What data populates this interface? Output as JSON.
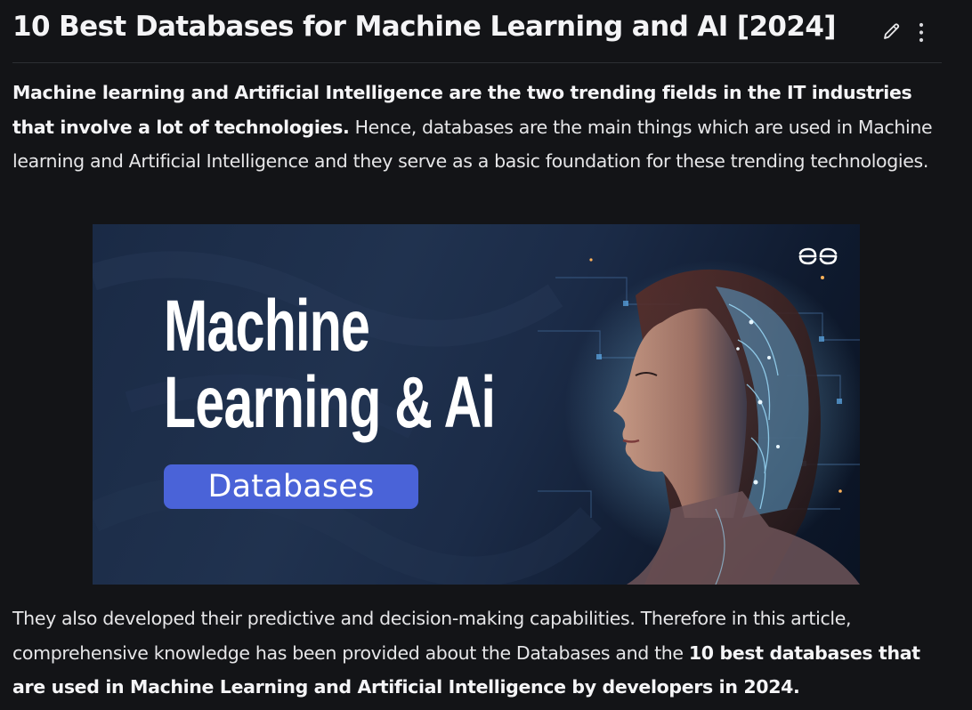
{
  "article": {
    "title": "10 Best Databases for Machine Learning and AI [2024]",
    "intro": {
      "bold": "Machine learning and Artificial Intelligence are the two trending fields in the IT industries that involve a lot of technologies.",
      "text": " Hence, databases are the main things which are used in Machine learning and Artificial Intelligence and they serve as a basic foundation for these trending technologies."
    },
    "outro": {
      "text": "They also developed their predictive and decision-making capabilities. Therefore in this article, comprehensive knowledge has been provided about the Databases and the ",
      "bold": "10 best databases that are used in Machine Learning and Artificial Intelligence by developers in 2024."
    }
  },
  "header": {
    "edit_icon": "pencil-icon",
    "more_icon": "vertical-ellipsis-icon"
  },
  "banner": {
    "line1": "Machine",
    "line2": "Learning & Ai",
    "pill": "Databases",
    "logo_icon": "gfg-logo-icon",
    "pill_color": "#4a63d8",
    "background_color": "#1b2b47"
  }
}
